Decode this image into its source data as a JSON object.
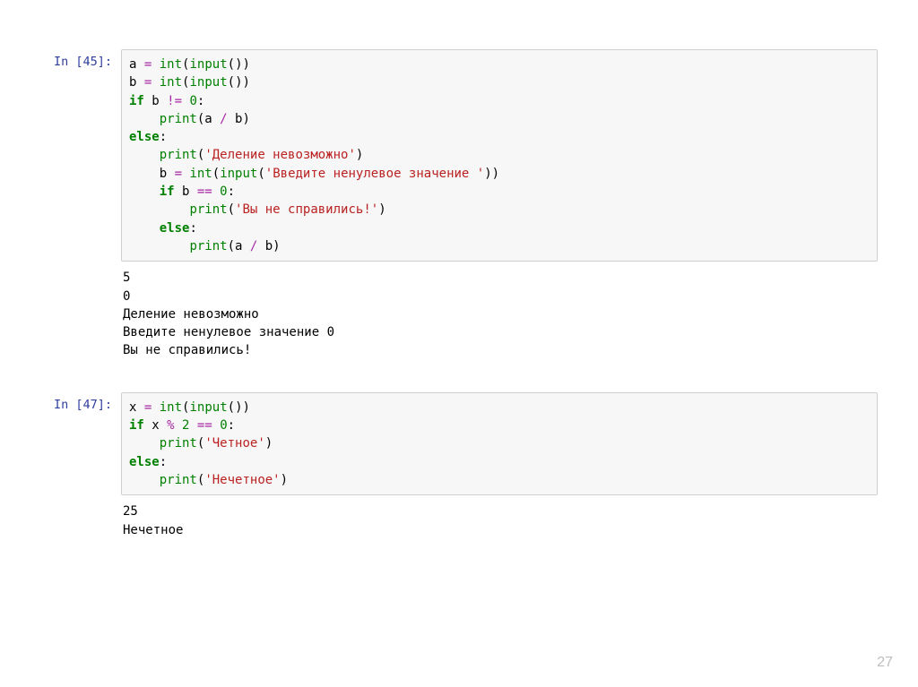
{
  "page_number": "27",
  "cells": [
    {
      "prompt": "In [45]:",
      "code_tokens": [
        {
          "t": "a",
          "c": "var"
        },
        {
          "t": " ",
          "c": "sp"
        },
        {
          "t": "=",
          "c": "op"
        },
        {
          "t": " ",
          "c": "sp"
        },
        {
          "t": "int",
          "c": "fn"
        },
        {
          "t": "(",
          "c": "punc"
        },
        {
          "t": "input",
          "c": "fn"
        },
        {
          "t": "())",
          "c": "punc"
        },
        {
          "t": "\n",
          "c": "nl"
        },
        {
          "t": "b",
          "c": "var"
        },
        {
          "t": " ",
          "c": "sp"
        },
        {
          "t": "=",
          "c": "op"
        },
        {
          "t": " ",
          "c": "sp"
        },
        {
          "t": "int",
          "c": "fn"
        },
        {
          "t": "(",
          "c": "punc"
        },
        {
          "t": "input",
          "c": "fn"
        },
        {
          "t": "())",
          "c": "punc"
        },
        {
          "t": "\n",
          "c": "nl"
        },
        {
          "t": "if",
          "c": "kw"
        },
        {
          "t": " b ",
          "c": "var"
        },
        {
          "t": "!=",
          "c": "op"
        },
        {
          "t": " ",
          "c": "sp"
        },
        {
          "t": "0",
          "c": "num"
        },
        {
          "t": ":",
          "c": "punc"
        },
        {
          "t": "\n",
          "c": "nl"
        },
        {
          "t": "    ",
          "c": "sp"
        },
        {
          "t": "print",
          "c": "fn"
        },
        {
          "t": "(a ",
          "c": "punc"
        },
        {
          "t": "/",
          "c": "op"
        },
        {
          "t": " b)",
          "c": "punc"
        },
        {
          "t": "\n",
          "c": "nl"
        },
        {
          "t": "else",
          "c": "kw"
        },
        {
          "t": ":",
          "c": "punc"
        },
        {
          "t": "\n",
          "c": "nl"
        },
        {
          "t": "    ",
          "c": "sp"
        },
        {
          "t": "print",
          "c": "fn"
        },
        {
          "t": "(",
          "c": "punc"
        },
        {
          "t": "'Деление невозможно'",
          "c": "str"
        },
        {
          "t": ")",
          "c": "punc"
        },
        {
          "t": "\n",
          "c": "nl"
        },
        {
          "t": "    b ",
          "c": "var"
        },
        {
          "t": "=",
          "c": "op"
        },
        {
          "t": " ",
          "c": "sp"
        },
        {
          "t": "int",
          "c": "fn"
        },
        {
          "t": "(",
          "c": "punc"
        },
        {
          "t": "input",
          "c": "fn"
        },
        {
          "t": "(",
          "c": "punc"
        },
        {
          "t": "'Введите ненулевое значение '",
          "c": "str"
        },
        {
          "t": "))",
          "c": "punc"
        },
        {
          "t": "\n",
          "c": "nl"
        },
        {
          "t": "    ",
          "c": "sp"
        },
        {
          "t": "if",
          "c": "kw"
        },
        {
          "t": " b ",
          "c": "var"
        },
        {
          "t": "==",
          "c": "op"
        },
        {
          "t": " ",
          "c": "sp"
        },
        {
          "t": "0",
          "c": "num"
        },
        {
          "t": ":",
          "c": "punc"
        },
        {
          "t": "\n",
          "c": "nl"
        },
        {
          "t": "        ",
          "c": "sp"
        },
        {
          "t": "print",
          "c": "fn"
        },
        {
          "t": "(",
          "c": "punc"
        },
        {
          "t": "'Вы не справились!'",
          "c": "str"
        },
        {
          "t": ")",
          "c": "punc"
        },
        {
          "t": "\n",
          "c": "nl"
        },
        {
          "t": "    ",
          "c": "sp"
        },
        {
          "t": "else",
          "c": "kw"
        },
        {
          "t": ":",
          "c": "punc"
        },
        {
          "t": "\n",
          "c": "nl"
        },
        {
          "t": "        ",
          "c": "sp"
        },
        {
          "t": "print",
          "c": "fn"
        },
        {
          "t": "(a ",
          "c": "punc"
        },
        {
          "t": "/",
          "c": "op"
        },
        {
          "t": " b)",
          "c": "punc"
        }
      ],
      "output": "5\n0\nДеление невозможно\nВведите ненулевое значение 0\nВы не справились!"
    },
    {
      "prompt": "In [47]:",
      "code_tokens": [
        {
          "t": "x",
          "c": "var"
        },
        {
          "t": " ",
          "c": "sp"
        },
        {
          "t": "=",
          "c": "op"
        },
        {
          "t": " ",
          "c": "sp"
        },
        {
          "t": "int",
          "c": "fn"
        },
        {
          "t": "(",
          "c": "punc"
        },
        {
          "t": "input",
          "c": "fn"
        },
        {
          "t": "())",
          "c": "punc"
        },
        {
          "t": "\n",
          "c": "nl"
        },
        {
          "t": "if",
          "c": "kw"
        },
        {
          "t": " x ",
          "c": "var"
        },
        {
          "t": "%",
          "c": "op"
        },
        {
          "t": " ",
          "c": "sp"
        },
        {
          "t": "2",
          "c": "num"
        },
        {
          "t": " ",
          "c": "sp"
        },
        {
          "t": "==",
          "c": "op"
        },
        {
          "t": " ",
          "c": "sp"
        },
        {
          "t": "0",
          "c": "num"
        },
        {
          "t": ":",
          "c": "punc"
        },
        {
          "t": "\n",
          "c": "nl"
        },
        {
          "t": "    ",
          "c": "sp"
        },
        {
          "t": "print",
          "c": "fn"
        },
        {
          "t": "(",
          "c": "punc"
        },
        {
          "t": "'Четное'",
          "c": "str"
        },
        {
          "t": ")",
          "c": "punc"
        },
        {
          "t": "\n",
          "c": "nl"
        },
        {
          "t": "else",
          "c": "kw"
        },
        {
          "t": ":",
          "c": "punc"
        },
        {
          "t": "\n",
          "c": "nl"
        },
        {
          "t": "    ",
          "c": "sp"
        },
        {
          "t": "print",
          "c": "fn"
        },
        {
          "t": "(",
          "c": "punc"
        },
        {
          "t": "'Нечетное'",
          "c": "str"
        },
        {
          "t": ")",
          "c": "punc"
        }
      ],
      "output": "25\nНечетное"
    }
  ]
}
